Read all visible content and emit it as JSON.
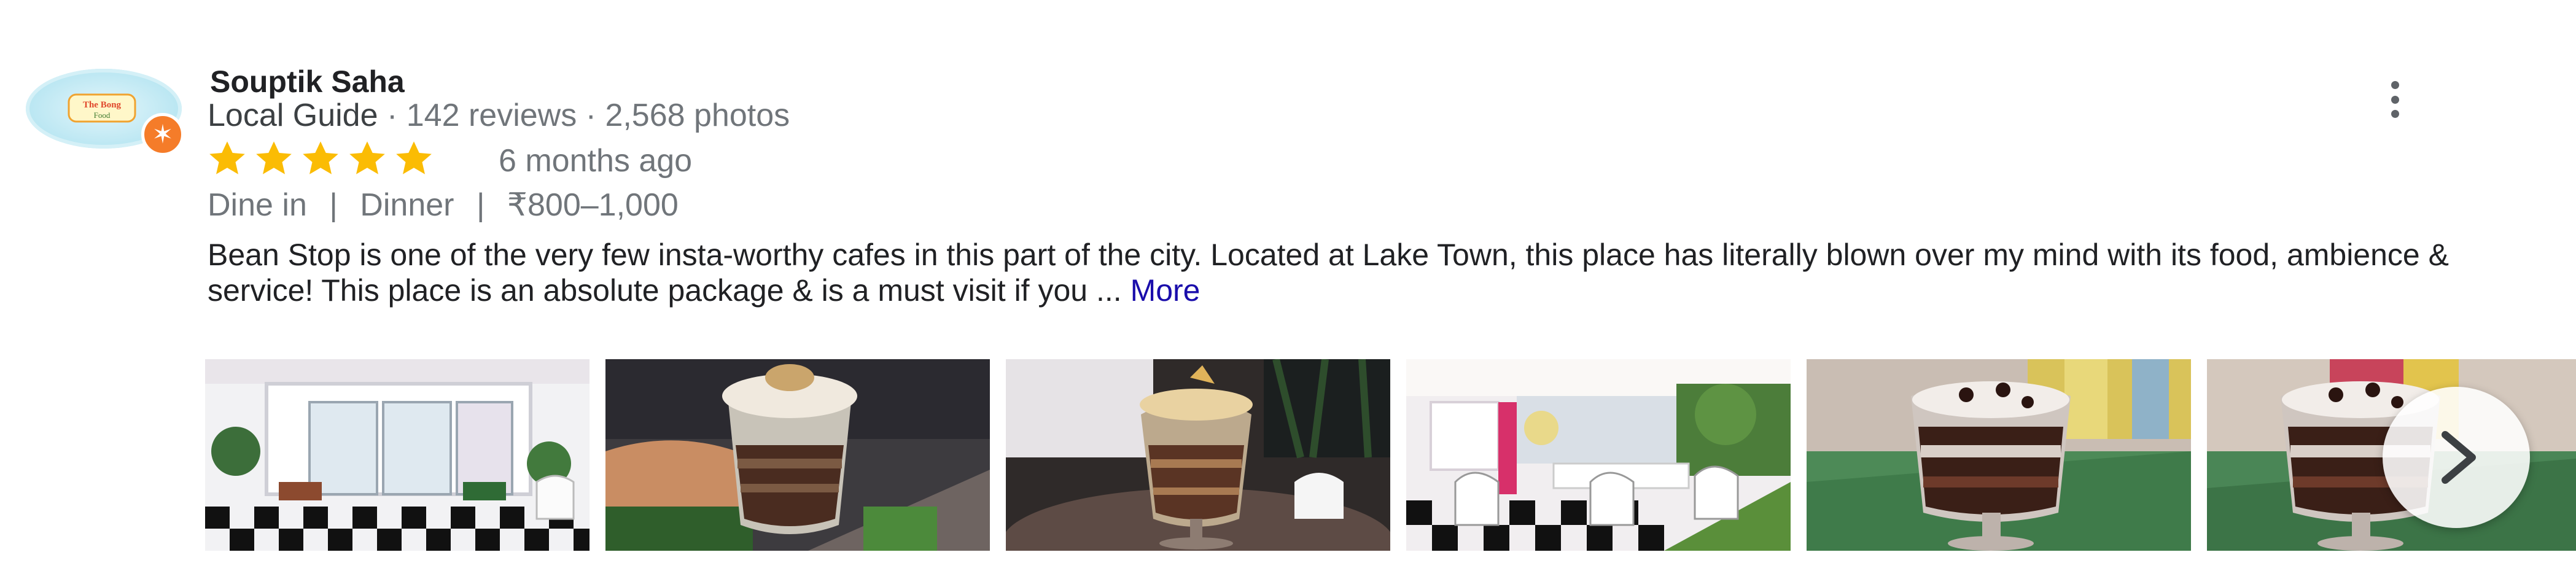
{
  "reviewer": {
    "name": "Souptik Saha",
    "guide_label": "Local Guide",
    "reviews": "142 reviews",
    "photos": "2,568 photos",
    "avatar_text": "The Bong Food",
    "badge_icon": "local-guide-star-icon"
  },
  "rating": {
    "stars": 5,
    "max": 5,
    "color": "#fbbc04",
    "time": "6 months ago"
  },
  "tags": {
    "service": "Dine in",
    "meal": "Dinner",
    "price": "₹800–1,000",
    "separator": "|"
  },
  "review": {
    "text": "Bean Stop is one of the very few insta-worthy cafes in this part of the city. Located at Lake Town, this place has literally blown over my mind with its food, ambience & service! This place is an absolute package & is a must visit if you ...",
    "more_label": "More"
  },
  "photos": [
    {
      "subject": "cafe-entrance"
    },
    {
      "subject": "dessert-in-hand"
    },
    {
      "subject": "dessert-on-table"
    },
    {
      "subject": "cafe-interior"
    },
    {
      "subject": "brownie-dessert"
    },
    {
      "subject": "brownie-dessert-2"
    }
  ],
  "icons": {
    "more": "more-vertical-icon",
    "next": "chevron-right-icon"
  }
}
